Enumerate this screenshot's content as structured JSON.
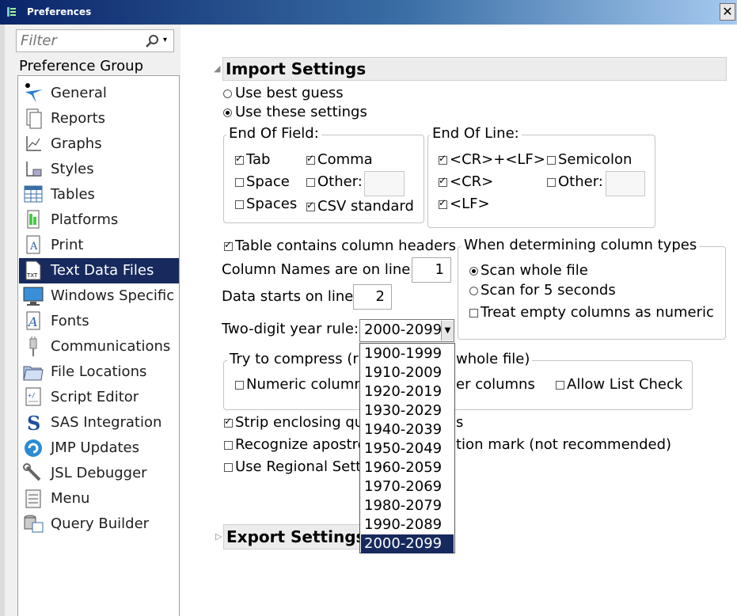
{
  "window": {
    "title": "Preferences",
    "close_glyph": "✕"
  },
  "filter": {
    "placeholder": "Filter",
    "dropdown_glyph": "▾"
  },
  "sidebar": {
    "group_label": "Preference Group",
    "items": [
      {
        "label": "General",
        "icon": "general-icon"
      },
      {
        "label": "Reports",
        "icon": "reports-icon"
      },
      {
        "label": "Graphs",
        "icon": "graphs-icon"
      },
      {
        "label": "Styles",
        "icon": "styles-icon"
      },
      {
        "label": "Tables",
        "icon": "tables-icon"
      },
      {
        "label": "Platforms",
        "icon": "platforms-icon"
      },
      {
        "label": "Print",
        "icon": "print-icon"
      },
      {
        "label": "Text Data Files",
        "icon": "text-data-files-icon",
        "selected": true
      },
      {
        "label": "Windows Specific",
        "icon": "monitor-icon"
      },
      {
        "label": "Fonts",
        "icon": "fonts-icon"
      },
      {
        "label": "Communications",
        "icon": "plug-icon"
      },
      {
        "label": "File Locations",
        "icon": "folder-icon"
      },
      {
        "label": "Script Editor",
        "icon": "script-editor-icon"
      },
      {
        "label": "SAS Integration",
        "icon": "sas-icon"
      },
      {
        "label": "JMP Updates",
        "icon": "jmp-updates-icon"
      },
      {
        "label": "JSL Debugger",
        "icon": "wrench-icon"
      },
      {
        "label": "Menu",
        "icon": "menu-icon"
      },
      {
        "label": "Query Builder",
        "icon": "query-builder-icon"
      }
    ]
  },
  "import": {
    "header": "Import Settings",
    "use_best_guess": "Use best guess",
    "use_these_settings": "Use these settings",
    "end_of_field": {
      "title": "End Of Field:",
      "tab": "Tab",
      "space": "Space",
      "spaces": "Spaces",
      "comma": "Comma",
      "other": "Other:",
      "csv": "CSV standard"
    },
    "end_of_line": {
      "title": "End Of Line:",
      "crlf": "<CR>+<LF>",
      "cr": "<CR>",
      "lf": "<LF>",
      "semicolon": "Semicolon",
      "other": "Other:"
    },
    "table_headers": "Table contains column headers",
    "column_names_line_label": "Column Names are on line:",
    "column_names_line_value": "1",
    "data_starts_label": "Data starts on line:",
    "data_starts_value": "2",
    "column_types": {
      "title": "When determining column types",
      "scan_whole": "Scan whole file",
      "scan_seconds": "Scan for 5 seconds",
      "treat_empty": "Treat empty columns as numeric"
    },
    "year_rule_label": "Two-digit year rule:",
    "year_rule_value": "2000-2099",
    "compress": {
      "title_visible_left": "Try to compress (r",
      "title_visible_right": "whole file)",
      "numeric": "Numeric column",
      "other": "er columns",
      "allow_list": "Allow List Check"
    },
    "strip_quotes": "Strip enclosing qu",
    "strip_quotes_tail": "s",
    "recognize_apostrophe": "Recognize apostro",
    "recognize_apostrophe_tail": "tion mark (not recommended)",
    "regional": "Use Regional Sett"
  },
  "year_options": [
    "1900-1999",
    "1910-2009",
    "1920-2019",
    "1930-2029",
    "1940-2039",
    "1950-2049",
    "1960-2059",
    "1970-2069",
    "1980-2079",
    "1990-2089",
    "2000-2099"
  ],
  "export": {
    "header": "Export Settings"
  },
  "colors": {
    "selection": "#172a5e",
    "title_bar": "#0a246a"
  }
}
